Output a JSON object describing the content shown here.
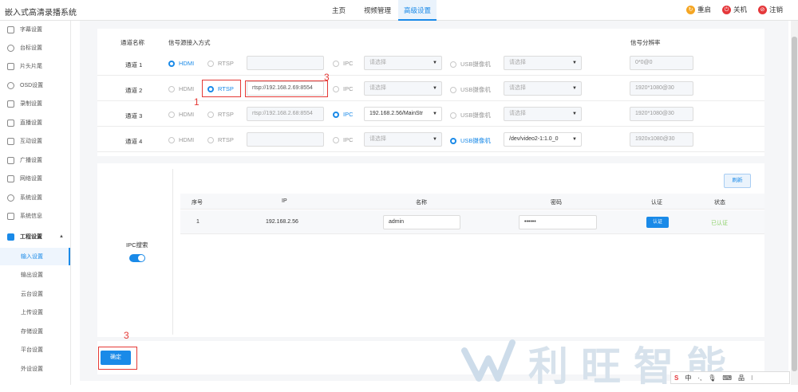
{
  "app_title": "嵌入式高清录播系统",
  "nav": {
    "home": "主页",
    "video": "视频管理",
    "advanced": "高级设置"
  },
  "actions": {
    "restart": "重启",
    "shutdown": "关机",
    "logout": "注销"
  },
  "sidebar": {
    "items": [
      "字幕设置",
      "台标设置",
      "片头片尾",
      "OSD设置",
      "录制设置",
      "直播设置",
      "互动设置",
      "广播设置",
      "网络设置",
      "系统设置",
      "系统信息"
    ],
    "engineering": "工程设置",
    "subs": [
      "输入设置",
      "输出设置",
      "云台设置",
      "上传设置",
      "存储设置",
      "平台设置",
      "外设设置"
    ]
  },
  "channel_table": {
    "headers": {
      "name": "通道名称",
      "input": "信号源接入方式",
      "resolution": "信号分辨率"
    },
    "rows": [
      {
        "name": "通道 1",
        "hdmi": "HDMI",
        "rtsp": "RTSP",
        "rtsp_url": "",
        "ipc": "IPC",
        "ipc_select": "请选择",
        "usb": "USB摄像机",
        "usb_select": "请选择",
        "resolution": "0*0@0"
      },
      {
        "name": "通道 2",
        "hdmi": "HDMI",
        "rtsp": "RTSP",
        "rtsp_url": "rtsp://192.168.2.69:8554",
        "ipc": "IPC",
        "ipc_select": "请选择",
        "usb": "USB摄像机",
        "usb_select": "请选择",
        "resolution": "1920*1080@30"
      },
      {
        "name": "通道 3",
        "hdmi": "HDMI",
        "rtsp": "RTSP",
        "rtsp_url": "rtsp://192.168.2.68:8554",
        "ipc": "IPC",
        "ipc_select": "192.168.2.56/MainStr",
        "usb": "USB摄像机",
        "usb_select": "请选择",
        "resolution": "1920*1080@30"
      },
      {
        "name": "通道 4",
        "hdmi": "HDMI",
        "rtsp": "RTSP",
        "rtsp_url": "",
        "ipc": "IPC",
        "ipc_select": "请选择",
        "usb": "USB摄像机",
        "usb_select": "/dev/video2-1:1.0_0",
        "resolution": "1920x1080@30"
      }
    ]
  },
  "ipc_search": {
    "label": "IPC搜索",
    "refresh": "刷新",
    "headers": {
      "index": "序号",
      "ip": "IP",
      "name": "名称",
      "password": "密码",
      "auth": "认证",
      "status": "状态"
    },
    "row": {
      "index": "1",
      "ip": "192.168.2.56",
      "name": "admin",
      "password": "••••••",
      "auth_btn": "认证",
      "status": "已认证"
    }
  },
  "confirm": "确定",
  "annotations": {
    "a1": "1",
    "a2": "3",
    "a3": "3"
  },
  "watermark": "利旺智能",
  "ime": {
    "s": "S",
    "lang": "中",
    "dot": "·,",
    "mic": "🎙",
    "kb": "⌨",
    "grid": "品",
    "more": "⁝"
  }
}
